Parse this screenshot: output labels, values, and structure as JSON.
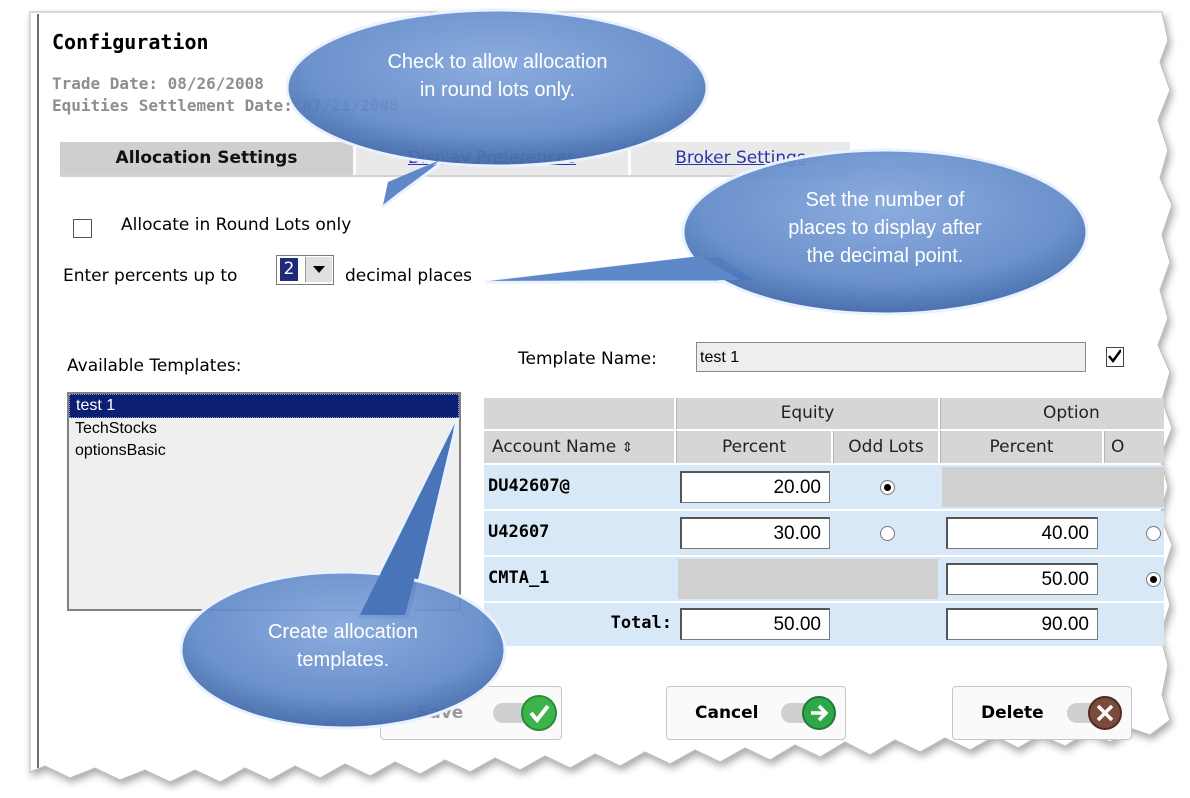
{
  "header": {
    "title": "Configuration",
    "trade_date": "Trade Date: 08/26/2008",
    "settlement_date": "Equities Settlement Date: 07/21/2008"
  },
  "tabs": [
    {
      "label": "Allocation Settings",
      "active": true
    },
    {
      "label": "Display Preferences",
      "active": false
    },
    {
      "label": "Broker Settings",
      "active": false
    }
  ],
  "settings": {
    "round_lots_label": "Allocate in Round Lots only",
    "round_lots_checked": false,
    "percent_prefix": "Enter percents up to",
    "decimal_value": "2",
    "percent_suffix": "decimal places"
  },
  "templates": {
    "label": "Available Templates:",
    "items": [
      "test 1",
      "TechStocks",
      "optionsBasic"
    ],
    "selected_index": 0
  },
  "template_name": {
    "label": "Template Name:",
    "value": "test 1"
  },
  "table": {
    "group_headers": [
      "Equity",
      "Option"
    ],
    "columns": [
      "Account Name",
      "Percent",
      "Odd Lots",
      "Percent",
      "O"
    ],
    "rows": [
      {
        "account": "DU42607@",
        "equity_percent": "20.00",
        "equity_odd_lot": "selected",
        "option_percent": "",
        "option_odd_lot": ""
      },
      {
        "account": "U42607",
        "equity_percent": "30.00",
        "equity_odd_lot": "unselected",
        "option_percent": "40.00",
        "option_odd_lot": "partial"
      },
      {
        "account": "CMTA_1",
        "equity_percent": "",
        "equity_odd_lot": "",
        "option_percent": "50.00",
        "option_odd_lot": "selected"
      }
    ],
    "total_label": "Total:",
    "total_equity": "50.00",
    "total_option": "90.00"
  },
  "buttons": {
    "save": "Save",
    "cancel": "Cancel",
    "delete": "Delete"
  },
  "callouts": {
    "round_lots": "Check to allow allocation\nin round lots only.",
    "decimal": "Set the number of\nplaces to display after\nthe decimal point.",
    "templates": "Create allocation\ntemplates."
  },
  "colors": {
    "callout_fill": "#5f88c8",
    "selected_item": "#0d1f73",
    "table_row": "#d8e8f6",
    "save_icon": "#3bb54a",
    "cancel_icon": "#2fa84a",
    "delete_icon": "#7a4a3a"
  }
}
